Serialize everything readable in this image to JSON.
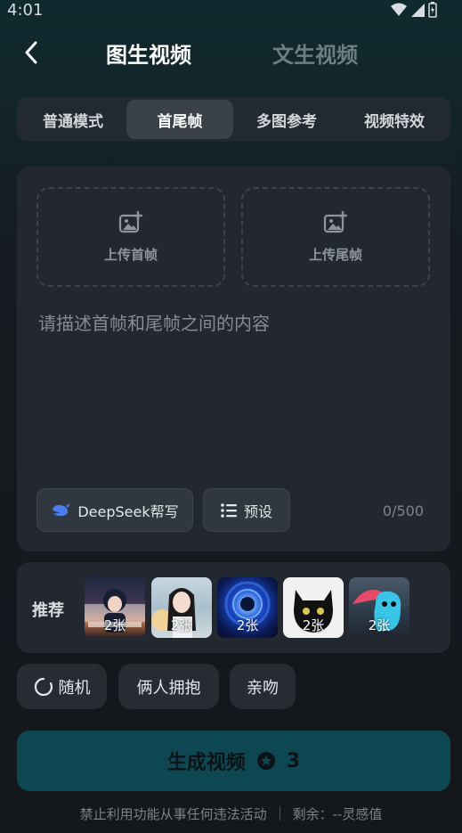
{
  "status_bar": {
    "time": "4:01"
  },
  "header": {
    "active_tab": "图生视频",
    "inactive_tab": "文生视频"
  },
  "modes": [
    {
      "label": "普通模式",
      "active": false
    },
    {
      "label": "首尾帧",
      "active": true
    },
    {
      "label": "多图参考",
      "active": false
    },
    {
      "label": "视频特效",
      "active": false
    }
  ],
  "upload": {
    "first_frame_label": "上传首帧",
    "last_frame_label": "上传尾帧"
  },
  "prompt": {
    "placeholder": "请描述首帧和尾帧之间的内容",
    "counter": "0/500"
  },
  "actions": {
    "deepseek_label": "DeepSeek帮写",
    "preset_label": "预设"
  },
  "recommend": {
    "label": "推荐",
    "items": [
      {
        "count": "2张",
        "theme": "anime-girl"
      },
      {
        "count": "2张",
        "theme": "girl-portrait"
      },
      {
        "count": "2张",
        "theme": "blue-vortex"
      },
      {
        "count": "2张",
        "theme": "black-cat"
      },
      {
        "count": "2张",
        "theme": "blue-creature"
      }
    ]
  },
  "tags": [
    {
      "label": "随机",
      "icon": "refresh-icon"
    },
    {
      "label": "俩人拥抱"
    },
    {
      "label": "亲吻"
    }
  ],
  "generate": {
    "label": "生成视频",
    "cost": "3"
  },
  "footer": {
    "notice": "禁止利用功能从事任何违法活动",
    "remaining": "剩余：--灵感值"
  },
  "colors": {
    "accent": "#0d4852",
    "panel": "#232830",
    "active_mode": "#3a4148"
  }
}
